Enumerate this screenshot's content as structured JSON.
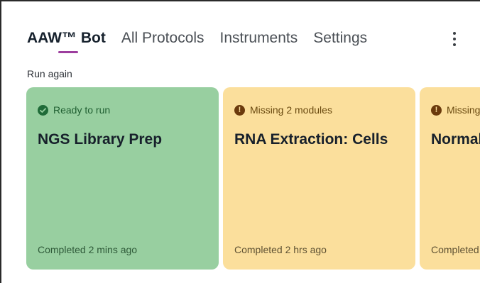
{
  "nav": {
    "tabs": [
      {
        "label": "AAW™ Bot",
        "active": true
      },
      {
        "label": "All Protocols",
        "active": false
      },
      {
        "label": "Instruments",
        "active": false
      },
      {
        "label": "Settings",
        "active": false
      }
    ],
    "overflow_icon": "more-vertical-icon"
  },
  "section": {
    "label": "Run again"
  },
  "cards": [
    {
      "status": "Ready to run",
      "status_icon": "check-circle-icon",
      "title": "NGS Library Prep",
      "footer_label": "Completed",
      "footer_time": "2 mins ago",
      "color": "#98cfa0"
    },
    {
      "status": "Missing 2 modules",
      "status_icon": "alert-circle-icon",
      "title": "RNA Extraction: Cells",
      "footer_label": "Completed",
      "footer_time": "2 hrs ago",
      "color": "#fbdf9c"
    },
    {
      "status": "Missing",
      "status_icon": "alert-circle-icon",
      "title": "Normal",
      "footer_label": "Completed",
      "footer_time": "",
      "color": "#fbdf9c"
    }
  ],
  "colors": {
    "accent": "#9d3e9e",
    "ready": "#98cfa0",
    "missing": "#fbdf9c"
  }
}
